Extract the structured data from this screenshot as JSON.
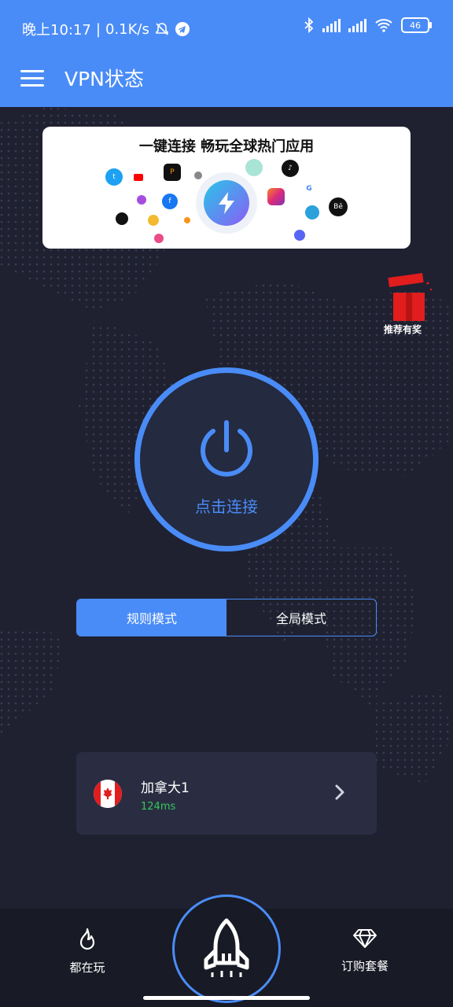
{
  "status": {
    "time": "晚上10:17",
    "speed": "0.1K/s",
    "battery": "46"
  },
  "header": {
    "title": "VPN状态"
  },
  "banner": {
    "title": "一键连接 畅玩全球热门应用"
  },
  "gift": {
    "label": "推荐有奖"
  },
  "power": {
    "label": "点击连接"
  },
  "modes": {
    "rule": "规则模式",
    "global": "全局模式",
    "selected": "rule"
  },
  "server": {
    "name": "加拿大1",
    "ping": "124ms"
  },
  "nav": {
    "left_label": "都在玩",
    "right_label": "订购套餐"
  },
  "colors": {
    "accent": "#4a8cf7",
    "background": "#1f2131",
    "ping": "#34c759"
  }
}
